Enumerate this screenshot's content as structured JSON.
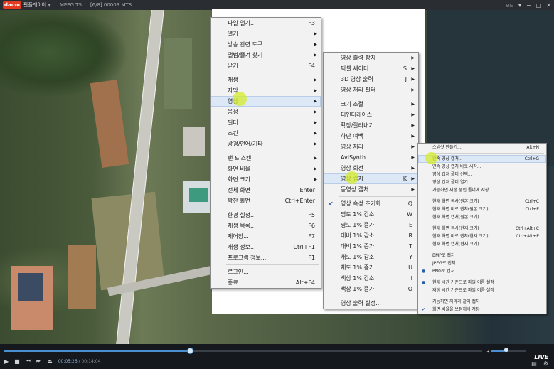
{
  "titlebar": {
    "logo": "daum",
    "app_name": "팟플레이어",
    "format": "MPEG TS",
    "file": "[6/8] 00009.MTS",
    "mode_label": "모드",
    "icons": [
      "menu-arrow-icon",
      "minimize-icon",
      "maximize-icon",
      "close-icon"
    ]
  },
  "main_menu": [
    {
      "label": "파일 열기...",
      "shortcut": "F3"
    },
    {
      "label": "열기",
      "arrow": true
    },
    {
      "label": "방송 관련 도구",
      "arrow": true
    },
    {
      "label": "앨범/즐겨 찾기",
      "arrow": true
    },
    {
      "label": "닫기",
      "shortcut": "F4"
    },
    {
      "sep": true
    },
    {
      "label": "재생",
      "arrow": true
    },
    {
      "label": "자막",
      "arrow": true
    },
    {
      "label": "영상",
      "arrow": true,
      "highlight": true
    },
    {
      "label": "음성",
      "arrow": true
    },
    {
      "label": "필터",
      "arrow": true
    },
    {
      "label": "스킨",
      "arrow": true
    },
    {
      "label": "광경/언어/기타",
      "arrow": true
    },
    {
      "sep": true
    },
    {
      "label": "팬 & 스캔",
      "arrow": true
    },
    {
      "label": "화면 비율",
      "arrow": true
    },
    {
      "label": "화면 크기",
      "arrow": true
    },
    {
      "label": "전체 화면",
      "shortcut": "Enter"
    },
    {
      "label": "꽉찬 화면",
      "shortcut": "Ctrl+Enter"
    },
    {
      "sep": true
    },
    {
      "label": "환경 설정...",
      "shortcut": "F5"
    },
    {
      "label": "재생 목록...",
      "shortcut": "F6"
    },
    {
      "label": "제어창...",
      "shortcut": "F7"
    },
    {
      "label": "재생 정보...",
      "shortcut": "Ctrl+F1"
    },
    {
      "label": "프로그램 정보...",
      "shortcut": "F1"
    },
    {
      "sep": true
    },
    {
      "label": "로그인..."
    },
    {
      "label": "종료",
      "shortcut": "Alt+F4"
    }
  ],
  "video_menu": [
    {
      "label": "영상 출력 장치",
      "arrow": true
    },
    {
      "label": "픽셀 셰이더",
      "shortcut": "S",
      "arrow": true
    },
    {
      "label": "3D 영상 출력",
      "shortcut": "J",
      "arrow": true
    },
    {
      "label": "영상 처리 필터",
      "arrow": true
    },
    {
      "sep": true
    },
    {
      "label": "크기 조절",
      "arrow": true
    },
    {
      "label": "디인터레이스",
      "arrow": true
    },
    {
      "label": "확장/잘라내기",
      "arrow": true
    },
    {
      "label": "하단 여백",
      "arrow": true
    },
    {
      "label": "영상 처리",
      "arrow": true
    },
    {
      "label": "AviSynth",
      "arrow": true
    },
    {
      "label": "영상 회전",
      "arrow": true
    },
    {
      "label": "영상 캡처",
      "shortcut": "K",
      "arrow": true,
      "highlight": true
    },
    {
      "label": "동영상 캡처",
      "arrow": true
    },
    {
      "sep": true
    },
    {
      "label": "영상 속성 초기화",
      "shortcut": "Q",
      "check": true
    },
    {
      "label": "명도 1% 감소",
      "shortcut": "W"
    },
    {
      "label": "명도 1% 증가",
      "shortcut": "E"
    },
    {
      "label": "대비 1% 감소",
      "shortcut": "R"
    },
    {
      "label": "대비 1% 증가",
      "shortcut": "T"
    },
    {
      "label": "채도 1% 감소",
      "shortcut": "Y"
    },
    {
      "label": "채도 1% 증가",
      "shortcut": "U"
    },
    {
      "label": "색상 1% 감소",
      "shortcut": "I"
    },
    {
      "label": "색상 1% 증가",
      "shortcut": "O"
    },
    {
      "sep": true
    },
    {
      "label": "영상 출력 설정..."
    }
  ],
  "capture_menu": [
    {
      "label": "스냅샷 만들기...",
      "shortcut": "Alt+N"
    },
    {
      "sep": true
    },
    {
      "label": "연속 영상 캡처...",
      "shortcut": "Ctrl+G",
      "highlight": true
    },
    {
      "label": "연속 영상 캡처 바로 시작..."
    },
    {
      "label": "영상 캡처 폴더 선택..."
    },
    {
      "label": "영상 캡처 폴더 열기"
    },
    {
      "label": "가능하면 재생 중인 폴더에 저장"
    },
    {
      "sep": true
    },
    {
      "label": "현재 화면 복사(원본 크기)",
      "shortcut": "Ctrl+C"
    },
    {
      "label": "현재 화면 바로 캡처(원본 크기)",
      "shortcut": "Ctrl+E"
    },
    {
      "label": "현재 화면 캡처(원본 크기)..."
    },
    {
      "sep": true
    },
    {
      "label": "현재 화면 복사(현재 크기)",
      "shortcut": "Ctrl+Alt+C"
    },
    {
      "label": "현재 화면 바로 캡처(현재 크기)",
      "shortcut": "Ctrl+Alt+E"
    },
    {
      "label": "현재 화면 캡처(현재 크기)..."
    },
    {
      "sep": true
    },
    {
      "label": "BMP로 캡처"
    },
    {
      "label": "JPEG로 캡처"
    },
    {
      "label": "PNG로 캡처",
      "dot": true
    },
    {
      "sep": true
    },
    {
      "label": "현재 시간 기준으로 파일 이름 설정",
      "dot": true
    },
    {
      "label": "재생 시간 기준으로 파일 이름 설정"
    },
    {
      "sep": true
    },
    {
      "label": "가능하면 자막과 같이 캡처"
    },
    {
      "label": "화면 비율을 보정해서 저장",
      "check": true
    }
  ],
  "player": {
    "time_current": "00:05:26",
    "time_sep": " / ",
    "time_total": "00:14:04",
    "progress_fraction": 0.387,
    "volume_fraction": 0.44,
    "live_label": "LIVE",
    "control_icons": [
      "play-icon",
      "stop-icon",
      "prev-icon",
      "next-icon",
      "eject-icon"
    ]
  },
  "colors": {
    "accent": "#4a8fd0",
    "menu_highlight": "#dde8f6",
    "click_marker": "#d6ec28"
  }
}
